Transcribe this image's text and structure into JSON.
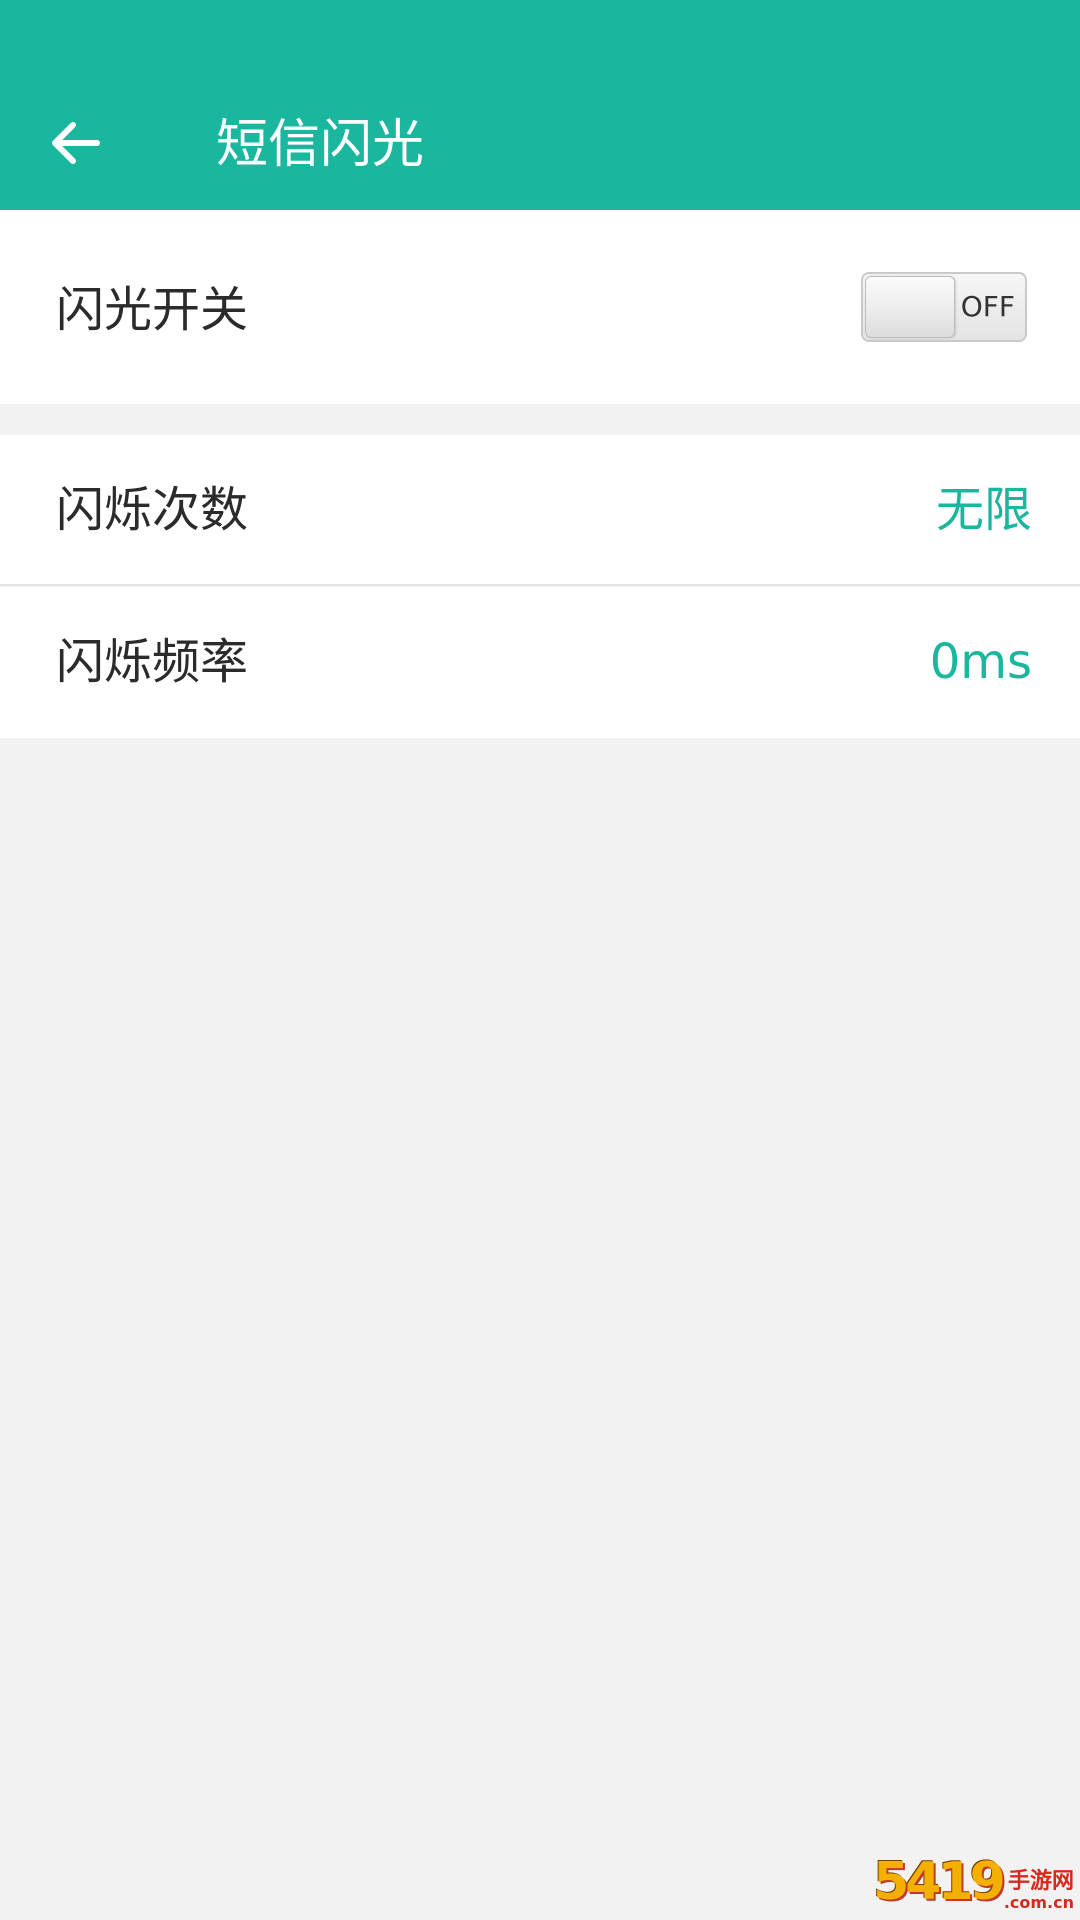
{
  "header": {
    "title": "短信闪光",
    "back_icon": "arrow-left-icon"
  },
  "settings": {
    "flash_switch": {
      "label": "闪光开关",
      "toggle_text": "OFF",
      "state": "off"
    },
    "blink_count": {
      "label": "闪烁次数",
      "value": "无限"
    },
    "blink_frequency": {
      "label": "闪烁频率",
      "value": "0ms"
    }
  },
  "watermark": {
    "number": "5419",
    "site": "手游网",
    "domain": ".com.cn"
  },
  "colors": {
    "accent": "#1ab69d",
    "background": "#f2f2f2",
    "row_background": "#ffffff",
    "label_text": "#2b2b2b"
  }
}
